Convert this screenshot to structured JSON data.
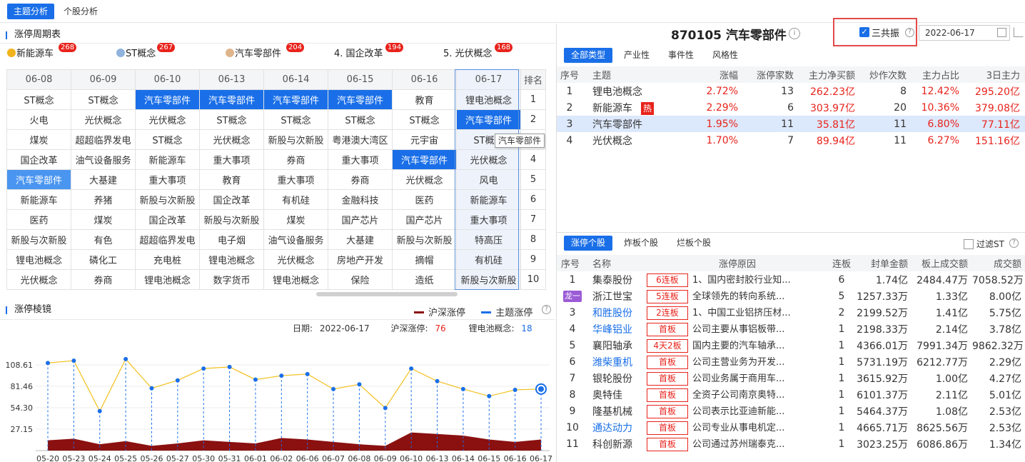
{
  "top_tabs": {
    "topic": "主题分析",
    "stock": "个股分析"
  },
  "cycle": {
    "title": "涨停周期表",
    "top_topics": [
      {
        "label": "新能源车",
        "count": "268",
        "icon": "coin-gold",
        "color": "#f2b31b"
      },
      {
        "label": "ST概念",
        "count": "267",
        "icon": "coin-blue",
        "color": "#8fb3dd"
      },
      {
        "label": "汽车零部件",
        "count": "204",
        "icon": "coin-tan",
        "color": "#e0b48a"
      },
      {
        "label": "4. 国企改革",
        "count": "194"
      },
      {
        "label": "5. 光伏概念",
        "count": "168"
      }
    ],
    "dates": [
      "06-08",
      "06-09",
      "06-10",
      "06-13",
      "06-14",
      "06-15",
      "06-16",
      "06-17"
    ],
    "rank_header": "排名",
    "rows": [
      [
        "ST概念",
        "ST概念",
        "汽车零部件",
        "汽车零部件",
        "汽车零部件",
        "汽车零部件",
        "教育",
        "锂电池概念"
      ],
      [
        "火电",
        "光伏概念",
        "光伏概念",
        "ST概念",
        "ST概念",
        "ST概念",
        "ST概念",
        "汽车零部件"
      ],
      [
        "煤炭",
        "超超临界发电",
        "ST概念",
        "光伏概念",
        "新股与次新股",
        "粤港澳大湾区",
        "元宇宙",
        "ST概念"
      ],
      [
        "国企改革",
        "油气设备服务",
        "新能源车",
        "重大事项",
        "券商",
        "重大事项",
        "汽车零部件",
        "光伏概念"
      ],
      [
        "汽车零部件",
        "大基建",
        "重大事项",
        "教育",
        "重大事项",
        "券商",
        "光伏概念",
        "风电"
      ],
      [
        "新能源车",
        "养猪",
        "新股与次新股",
        "国企改革",
        "有机硅",
        "金融科技",
        "医药",
        "新能源车"
      ],
      [
        "医药",
        "煤炭",
        "国企改革",
        "新股与次新股",
        "煤炭",
        "国产芯片",
        "国产芯片",
        "重大事项"
      ],
      [
        "新股与次新股",
        "有色",
        "超超临界发电",
        "电子烟",
        "油气设备服务",
        "大基建",
        "新股与次新股",
        "特高压"
      ],
      [
        "锂电池概念",
        "磷化工",
        "充电桩",
        "锂电池概念",
        "光伏概念",
        "房地产开发",
        "摘帽",
        "有机硅"
      ],
      [
        "光伏概念",
        "券商",
        "锂电池概念",
        "数字货币",
        "锂电池概念",
        "保险",
        "造纸",
        "新股与次新股"
      ]
    ],
    "ranks": [
      "1",
      "2",
      "3",
      "4",
      "5",
      "6",
      "7",
      "8",
      "9",
      "10"
    ],
    "tooltip": "汽车零部件",
    "colors": {
      "highlight": "#1a6fe8",
      "highlight_light": "#4a95f0"
    }
  },
  "mirror": {
    "title": "涨停棱镜",
    "legend_hs": "沪深涨停",
    "legend_topic": "主题涨停",
    "info": {
      "date_label": "日期:",
      "date": "2022-06-17",
      "hs_label": "沪深涨停:",
      "hs_value": "76",
      "topic_label": "锂电池概念:",
      "topic_value": "18"
    },
    "colors": {
      "hs": "#8b1010",
      "topic": "#1a6fe8",
      "line": "#f2c01e"
    }
  },
  "chart_data": {
    "type": "line",
    "x": [
      "05-20",
      "05-23",
      "05-24",
      "05-25",
      "05-26",
      "05-27",
      "05-30",
      "05-31",
      "06-01",
      "06-02",
      "06-06",
      "06-07",
      "06-08",
      "06-09",
      "06-10",
      "06-13",
      "06-14",
      "06-15",
      "06-16",
      "06-17"
    ],
    "y_ticks": [
      "108.61",
      "81.46",
      "54.30",
      "27.15"
    ],
    "ylim": [
      0,
      135.8
    ],
    "series": [
      {
        "name": "主题涨停",
        "values": [
          111,
          114,
          50,
          116,
          79,
          89,
          104,
          106,
          90,
          95,
          97,
          78,
          84,
          54,
          104,
          88,
          78,
          69,
          77,
          78
        ]
      },
      {
        "name": "沪深涨停",
        "values": [
          13,
          15,
          8,
          12,
          6,
          9,
          13,
          11,
          9,
          16,
          14,
          11,
          8,
          6,
          23,
          21,
          19,
          14,
          11,
          14
        ]
      }
    ]
  },
  "right": {
    "title": "870105 汽车零部件",
    "resonate_label": "三共振",
    "date": "2022-06-17",
    "type_tabs": [
      "全部类型",
      "产业性",
      "事件性",
      "风格性"
    ],
    "topic_headers": [
      "序号",
      "主题",
      "涨幅",
      "涨停家数",
      "主力净买额",
      "炒作次数",
      "主力占比",
      "3日主力"
    ],
    "topics": [
      {
        "no": "1",
        "name": "锂电池概念",
        "hot": "",
        "chg": "2.72%",
        "limit": "13",
        "net": "262.23亿",
        "times": "8",
        "ratio": "12.42%",
        "d3": "295.20亿"
      },
      {
        "no": "2",
        "name": "新能源车",
        "hot": "热",
        "chg": "2.29%",
        "limit": "6",
        "net": "303.97亿",
        "times": "20",
        "ratio": "10.36%",
        "d3": "379.08亿"
      },
      {
        "no": "3",
        "name": "汽车零部件",
        "hot": "",
        "chg": "1.95%",
        "limit": "11",
        "net": "35.81亿",
        "times": "11",
        "ratio": "6.80%",
        "d3": "77.11亿"
      },
      {
        "no": "4",
        "name": "光伏概念",
        "hot": "",
        "chg": "1.70%",
        "limit": "7",
        "net": "89.94亿",
        "times": "11",
        "ratio": "6.27%",
        "d3": "151.16亿"
      }
    ],
    "stock_tabs": [
      "涨停个股",
      "炸板个股",
      "烂板个股"
    ],
    "filter_st": "过滤ST",
    "stock_headers": [
      "序号",
      "名称",
      "涨停原因",
      "连板",
      "封单金额",
      "板上成交额",
      "成交额"
    ],
    "stocks": [
      {
        "no": "1",
        "name": "集泰股份",
        "blue": false,
        "tag": "6连板",
        "reason": "1、国内密封胶行业知...",
        "boards": "6",
        "seal": "1.74亿",
        "onboard": "2484.47万",
        "turnover": "7058.52万"
      },
      {
        "no": "龙一",
        "name": "浙江世宝",
        "blue": false,
        "dragon": true,
        "tag": "5连板",
        "reason": "全球领先的转向系统...",
        "boards": "5",
        "seal": "1257.33万",
        "onboard": "1.33亿",
        "turnover": "8.00亿"
      },
      {
        "no": "3",
        "name": "和胜股份",
        "blue": true,
        "tag": "2连板",
        "reason": "1、中国工业铝挤压材...",
        "boards": "2",
        "seal": "2199.52万",
        "onboard": "1.41亿",
        "turnover": "5.75亿"
      },
      {
        "no": "4",
        "name": "华峰铝业",
        "blue": true,
        "tag": "首板",
        "reason": "公司主要从事铝板带...",
        "boards": "1",
        "seal": "2198.33万",
        "onboard": "2.14亿",
        "turnover": "3.78亿"
      },
      {
        "no": "5",
        "name": "襄阳轴承",
        "blue": false,
        "tag": "4天2板",
        "reason": "国内主要的汽车轴承...",
        "boards": "1",
        "seal": "4366.01万",
        "onboard": "7991.34万",
        "turnover": "9862.32万"
      },
      {
        "no": "6",
        "name": "潍柴重机",
        "blue": true,
        "tag": "首板",
        "reason": "公司主营业务为开发...",
        "boards": "1",
        "seal": "5731.19万",
        "onboard": "6212.77万",
        "turnover": "2.29亿"
      },
      {
        "no": "7",
        "name": "银轮股份",
        "blue": false,
        "tag": "首板",
        "reason": "公司业务属于商用车...",
        "boards": "1",
        "seal": "3615.92万",
        "onboard": "1.00亿",
        "turnover": "4.27亿"
      },
      {
        "no": "8",
        "name": "奥特佳",
        "blue": false,
        "tag": "首板",
        "reason": "全资子公司南京奥特...",
        "boards": "1",
        "seal": "6101.37万",
        "onboard": "2.11亿",
        "turnover": "5.01亿"
      },
      {
        "no": "9",
        "name": "隆基机械",
        "blue": false,
        "tag": "首板",
        "reason": "公司表示比亚迪新能...",
        "boards": "1",
        "seal": "5464.37万",
        "onboard": "1.08亿",
        "turnover": "2.53亿"
      },
      {
        "no": "10",
        "name": "通达动力",
        "blue": true,
        "tag": "首板",
        "reason": "公司专业从事电机定...",
        "boards": "1",
        "seal": "4665.71万",
        "onboard": "8625.56万",
        "turnover": "2.53亿"
      },
      {
        "no": "11",
        "name": "科创新源",
        "blue": false,
        "tag": "首板",
        "reason": "公司通过苏州瑞泰克...",
        "boards": "1",
        "seal": "3023.25万",
        "onboard": "6086.86万",
        "turnover": "1.34亿"
      }
    ]
  }
}
